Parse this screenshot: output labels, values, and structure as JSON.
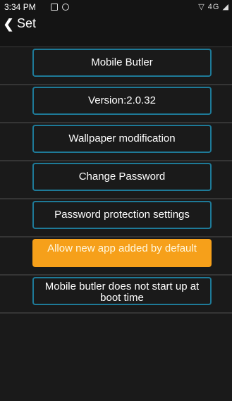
{
  "status_bar": {
    "time": "3:34 PM",
    "right": "4G"
  },
  "header": {
    "title": "Set"
  },
  "buttons": [
    {
      "label": "Mobile Butler"
    },
    {
      "label": "Version:2.0.32"
    },
    {
      "label": "Wallpaper modification"
    },
    {
      "label": "Change Password"
    },
    {
      "label": "Password protection settings"
    },
    {
      "label": "Allow new app added by default"
    },
    {
      "label": "Mobile butler does not start up at boot time"
    }
  ],
  "colors": {
    "accent_border": "#1e7a98",
    "active_button": "#f6a01a",
    "background": "#1a1a1a"
  }
}
